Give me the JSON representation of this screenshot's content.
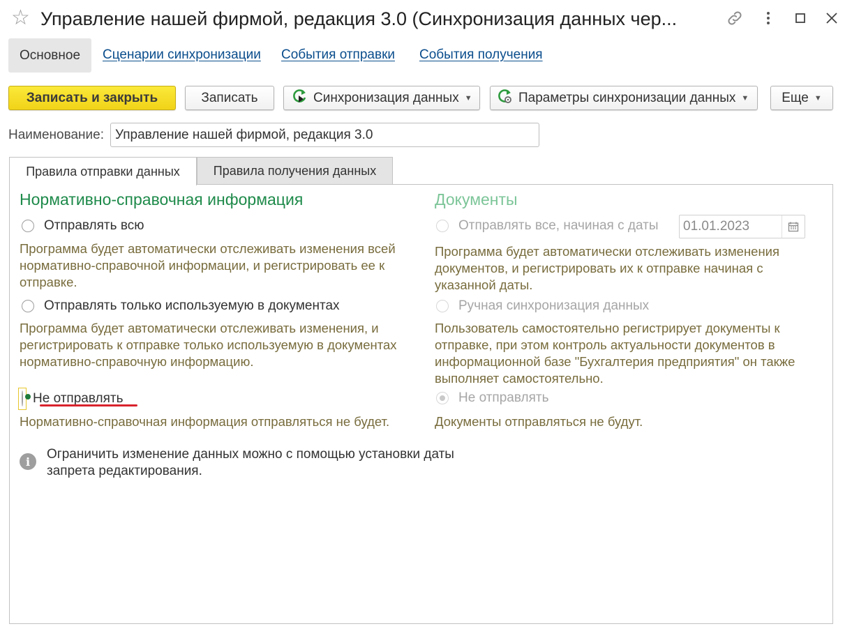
{
  "window": {
    "title": "Управление нашей фирмой, редакция 3.0 (Синхронизация данных чер...",
    "star_icon": "star-icon",
    "link_icon": "link-icon",
    "more_icon": "vertical-dots-icon",
    "maximize_icon": "maximize-icon",
    "close_icon": "close-icon"
  },
  "nav": {
    "active": "Основное",
    "links": [
      "Сценарии синхронизации",
      "События отправки",
      "События получения"
    ]
  },
  "toolbar": {
    "save_close": "Записать и закрыть",
    "save": "Записать",
    "sync": "Синхронизация данных",
    "sync_params": "Параметры синхронизации данных",
    "more": "Еще"
  },
  "name": {
    "label": "Наименование:",
    "value": "Управление нашей фирмой, редакция 3.0"
  },
  "tabs": [
    "Правила отправки данных",
    "Правила получения данных"
  ],
  "nsi": {
    "title": "Нормативно-справочная информация",
    "opt1_label": "Отправлять всю",
    "opt1_desc": "Программа будет автоматически отслеживать изменения всей нормативно-справочной информации, и регистрировать ее к отправке.",
    "opt2_label": "Отправлять только используемую в документах",
    "opt2_desc": "Программа будет автоматически отслеживать изменения, и регистрировать к отправке только используемую в документах нормативно-справочную информацию.",
    "opt3_label": "Не отправлять",
    "opt3_desc": "Нормативно-справочная информация отправляться не будет."
  },
  "docs": {
    "title": "Документы",
    "opt1_label": "Отправлять все, начиная с даты",
    "date": "01.01.2023",
    "opt1_desc": "Программа будет автоматически отслеживать изменения документов, и регистрировать их к отправке начиная с указанной даты.",
    "opt2_label": "Ручная синхронизация данных",
    "opt2_desc": "Пользователь самостоятельно регистрирует документы к отправке, при этом контроль актуальности документов в информационной базе \"Бухгалтерия предприятия\" он также выполняет самостоятельно.",
    "opt3_label": "Не отправлять",
    "opt3_desc": "Документы отправляться не будут."
  },
  "info": {
    "text": "Ограничить изменение данных можно с помощью установки даты запрета редактирования."
  },
  "colors": {
    "accent_green": "#1e8a4a",
    "description": "#786c3d",
    "primary_button": "#f4d829",
    "highlight_underline": "#d9232d"
  }
}
